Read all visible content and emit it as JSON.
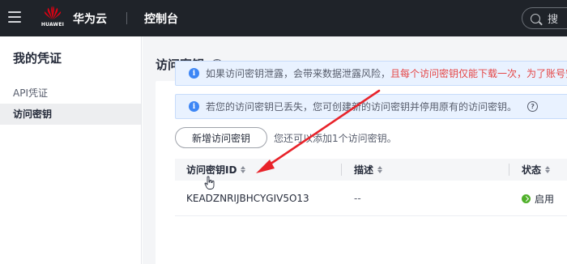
{
  "header": {
    "logo_text": "HUAWEI",
    "brand": "华为云",
    "console": "控制台",
    "search_placeholder": "搜"
  },
  "sidebar": {
    "title": "我的凭证",
    "items": [
      {
        "label": "API凭证",
        "active": false
      },
      {
        "label": "访问密钥",
        "active": true
      }
    ]
  },
  "main": {
    "title": "访问密钥",
    "notice1": {
      "text": "如果访问密钥泄露，会带来数据泄露风险，",
      "red_text": "且每个访问密钥仅能下载一次，为了账号安全性"
    },
    "notice2": {
      "text": "若您的访问密钥已丢失，您可创建新的访问密钥并停用原有的访问密钥。"
    },
    "add_button": "新增访问密钥",
    "hint": "您还可以添加1个访问密钥。",
    "table": {
      "headers": [
        "访问密钥ID",
        "描述",
        "状态"
      ],
      "rows": [
        {
          "id": "KEADZNRIJBHCYGIV5O13",
          "description": "--",
          "status": "启用"
        }
      ]
    }
  },
  "colors": {
    "topbar": "#1f2329",
    "accent_blue": "#3d86f5",
    "warning_red": "#e54545",
    "status_green": "#50b02a",
    "annotation_arrow": "#e8232a"
  },
  "icons": {
    "menu": "hamburger-icon",
    "logo": "huawei-logo-icon",
    "search": "search-icon",
    "help": "question-circle-icon",
    "info": "info-circle-icon",
    "sort": "sort-icon",
    "status": "check-circle-icon",
    "pointer": "hand-cursor-icon"
  }
}
